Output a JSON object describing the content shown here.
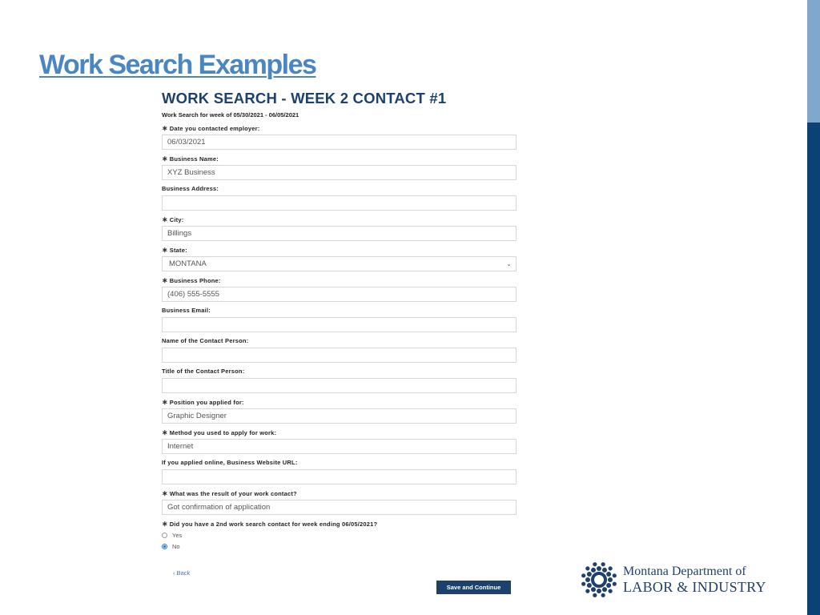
{
  "slide": {
    "title": "Work Search Examples",
    "colors": {
      "title": "#4a86c0",
      "navy": "#1d416d",
      "sidebar_dark": "#0b4275",
      "sidebar_light": "#7fa8cc"
    }
  },
  "form": {
    "title": "WORK SEARCH - WEEK 2 CONTACT #1",
    "subtitle": "Work Search for week of 05/30/2021 - 06/05/2021",
    "required_marker": "∗",
    "fields": [
      {
        "label": "Date you contacted employer:",
        "required": true,
        "value": "06/03/2021"
      },
      {
        "label": "Business Name:",
        "required": true,
        "value": "XYZ Business"
      },
      {
        "label": "Business Address:",
        "required": false,
        "value": ""
      },
      {
        "label": "City:",
        "required": true,
        "value": "Billings"
      },
      {
        "label": "State:",
        "required": true,
        "value": "MONTANA",
        "type": "select"
      },
      {
        "label": "Business Phone:",
        "required": true,
        "value": "(406) 555-5555"
      },
      {
        "label": "Business Email:",
        "required": false,
        "value": ""
      },
      {
        "label": "Name of the Contact Person:",
        "required": false,
        "value": ""
      },
      {
        "label": "Title of the Contact Person:",
        "required": false,
        "value": ""
      },
      {
        "label": "Position you applied for:",
        "required": true,
        "value": "Graphic Designer"
      },
      {
        "label": "Method you used to apply for work:",
        "required": true,
        "value": "Internet"
      },
      {
        "label": "If you applied online, Business Website URL:",
        "required": false,
        "value": ""
      },
      {
        "label": "What was the result of your work contact?",
        "required": true,
        "value": "Got confirmation of application"
      }
    ],
    "second_contact": {
      "label": "Did you have a 2nd work search contact for week ending 06/05/2021?",
      "options": [
        {
          "label": "Yes",
          "checked": false
        },
        {
          "label": "No",
          "checked": true
        }
      ]
    },
    "back_label": "Back",
    "save_label": "Save and Continue",
    "select_chevron": "⌄"
  },
  "logo": {
    "line1": "Montana Department of",
    "line2": "LABOR & INDUSTRY"
  }
}
